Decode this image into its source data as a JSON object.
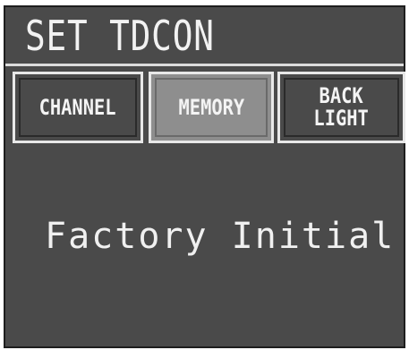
{
  "screen": {
    "title": "SET TDCON",
    "message": "Factory Initial"
  },
  "tabs": [
    {
      "label": "CHANNEL",
      "active": false
    },
    {
      "label": "MEMORY",
      "active": true
    },
    {
      "label": "BACK\nLIGHT",
      "active": false
    }
  ],
  "colors": {
    "lcd_background": "#4a4a4a",
    "active_tab": "#8e8e8e",
    "text": "#f2f2f2"
  }
}
